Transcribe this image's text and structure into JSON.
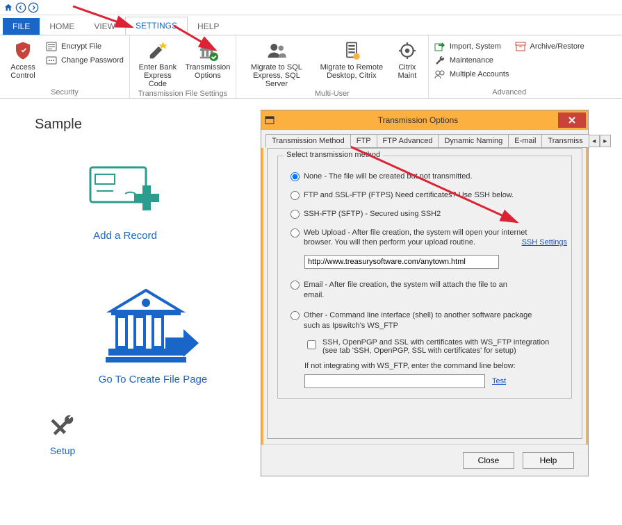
{
  "tabs": {
    "file": "FILE",
    "home": "HOME",
    "view": "VIEW",
    "settings": "SETTINGS",
    "help": "HELP"
  },
  "ribbon": {
    "security": {
      "access_control": "Access\nControl",
      "encrypt": "Encrypt File",
      "change_pw": "Change Password",
      "label": "Security"
    },
    "transmission": {
      "enter_bank": "Enter Bank\nExpress Code",
      "options": "Transmission\nOptions",
      "label": "Transmission File Settings"
    },
    "multiuser": {
      "migrate_sql": "Migrate to SQL\nExpress, SQL Server",
      "migrate_remote": "Migrate to Remote\nDesktop, Citrix",
      "citrix": "Citrix\nMaint",
      "label": "Multi-User"
    },
    "advanced": {
      "import": "Import, System",
      "maint": "Maintenance",
      "multi": "Multiple Accounts",
      "archive": "Archive/Restore",
      "label": "Advanced"
    }
  },
  "page": {
    "title": "Sample",
    "add_record": "Add a Record",
    "create_file": "Go To Create File Page",
    "setup": "Setup"
  },
  "dialog": {
    "title": "Transmission Options",
    "tabs": {
      "method": "Transmission Method",
      "ftp": "FTP",
      "ftpadv": "FTP Advanced",
      "dyn": "Dynamic Naming",
      "email": "E-mail",
      "trans": "Transmiss"
    },
    "fieldset_title": "Select transmission method",
    "opt_none": "None - The file will be created but not transmitted.",
    "opt_ftp": "FTP and SSL-FTP (FTPS) Need certificates? Use SSH below.",
    "opt_ssh": "SSH-FTP (SFTP) - Secured using SSH2",
    "ssh_link": "SSH Settings",
    "opt_web": "Web Upload - After file creation, the system will open your internet browser.  You will then perform your upload routine.",
    "web_url": "http://www.treasurysoftware.com/anytown.html",
    "opt_email": "Email - After file creation, the system will attach the file to an email.",
    "opt_other": "Other - Command line interface (shell) to another software package such as Ipswitch's WS_FTP",
    "chk_ssh": "SSH, OpenPGP and SSL with certificates with WS_FTP integration (see tab 'SSH, OpenPGP, SSL with certificates' for setup)",
    "cmd_label": "If not integrating with WS_FTP, enter the command line below:",
    "cmd_value": "",
    "test": "Test",
    "close": "Close",
    "help": "Help"
  }
}
